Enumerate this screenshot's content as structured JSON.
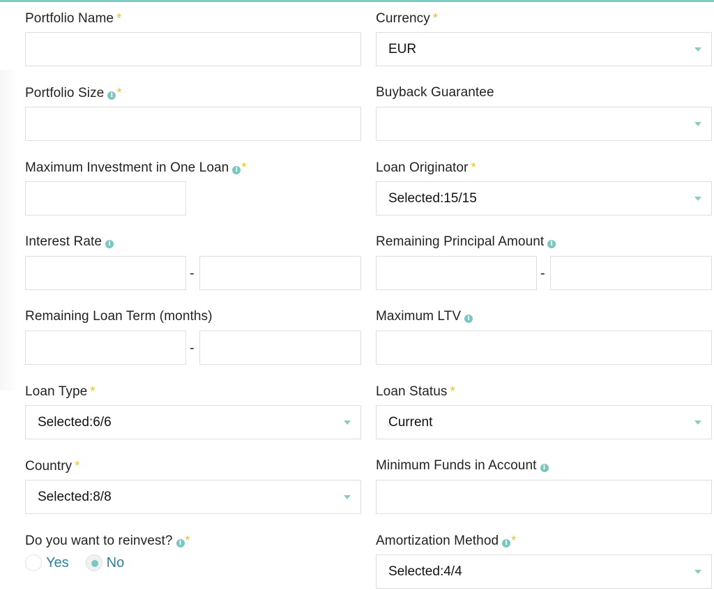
{
  "colors": {
    "accent": "#7fcac3",
    "required_star": "#e8c21c",
    "info_icon": "#7cc6c0",
    "radio_label": "#2f7f98",
    "input_border": "#dedede"
  },
  "required_mark": "*",
  "info_glyph": "i",
  "range_separator": "-",
  "fields": {
    "portfolio_name": {
      "label": "Portfolio Name",
      "value": ""
    },
    "currency": {
      "label": "Currency",
      "value": "EUR"
    },
    "portfolio_size": {
      "label": "Portfolio Size",
      "value": ""
    },
    "buyback_guarantee": {
      "label": "Buyback Guarantee",
      "value": ""
    },
    "max_investment": {
      "label": "Maximum Investment in One Loan",
      "value": ""
    },
    "loan_originator": {
      "label": "Loan Originator",
      "value": "Selected:15/15"
    },
    "interest_rate": {
      "label": "Interest Rate",
      "min": "",
      "max": ""
    },
    "remaining_principal": {
      "label": "Remaining Principal Amount",
      "min": "",
      "max": ""
    },
    "remaining_term": {
      "label": "Remaining Loan Term (months)",
      "min": "",
      "max": ""
    },
    "max_ltv": {
      "label": "Maximum LTV",
      "value": ""
    },
    "loan_type": {
      "label": "Loan Type",
      "value": "Selected:6/6"
    },
    "loan_status": {
      "label": "Loan Status",
      "value": "Current"
    },
    "country": {
      "label": "Country",
      "value": "Selected:8/8"
    },
    "min_funds": {
      "label": "Minimum Funds in Account",
      "value": ""
    },
    "reinvest": {
      "label": "Do you want to reinvest?",
      "options": [
        {
          "label": "Yes",
          "checked": false
        },
        {
          "label": "No",
          "checked": true
        }
      ]
    },
    "amortization": {
      "label": "Amortization Method",
      "value": "Selected:4/4"
    }
  }
}
